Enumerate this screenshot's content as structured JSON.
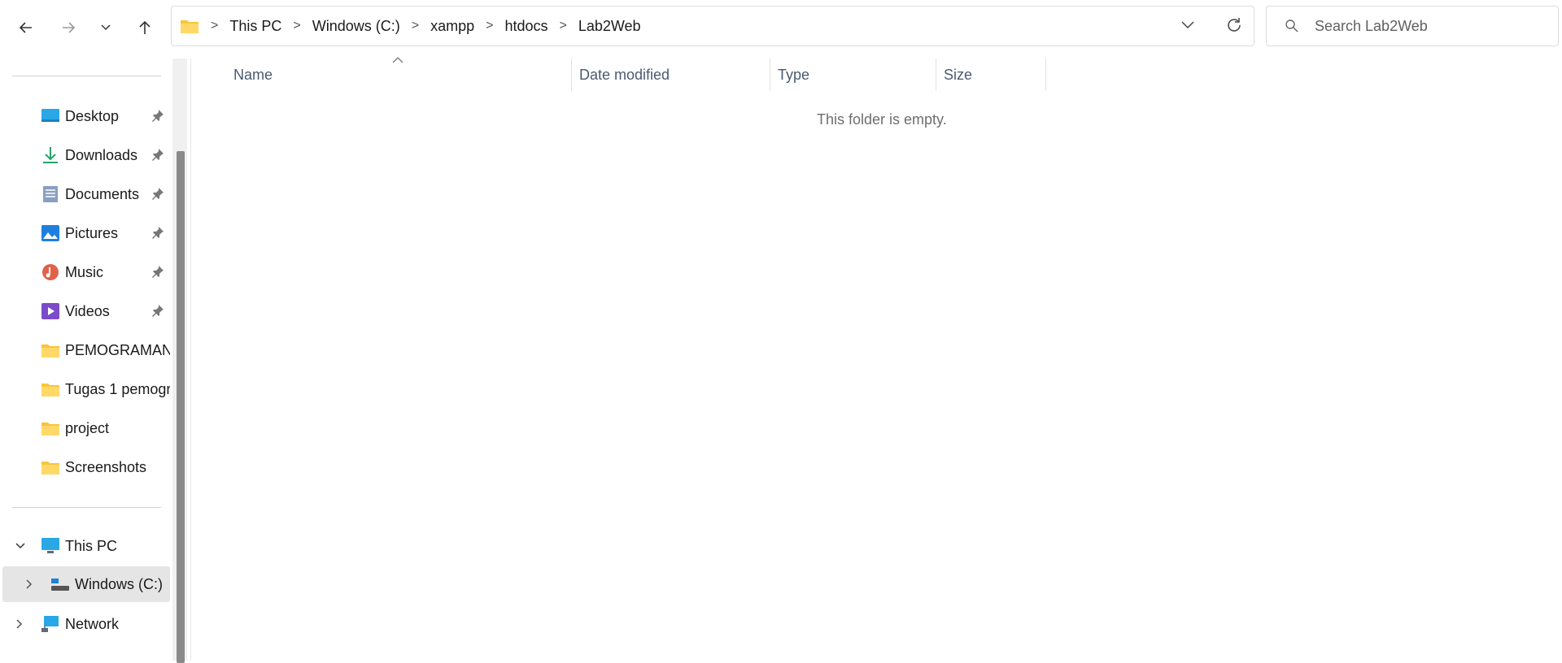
{
  "toolbar": {
    "back_icon": "arrow-left-icon",
    "forward_icon": "arrow-right-icon",
    "recent_icon": "chevron-down-icon",
    "up_icon": "arrow-up-icon"
  },
  "address": {
    "crumbs": [
      "This PC",
      "Windows (C:)",
      "xampp",
      "htdocs",
      "Lab2Web"
    ],
    "separator": ">"
  },
  "search": {
    "placeholder": "Search Lab2Web"
  },
  "sidebar": {
    "quick_access": [
      {
        "label": "Desktop",
        "icon": "desktop-icon",
        "pinned": true
      },
      {
        "label": "Downloads",
        "icon": "download-icon",
        "pinned": true
      },
      {
        "label": "Documents",
        "icon": "documents-icon",
        "pinned": true
      },
      {
        "label": "Pictures",
        "icon": "pictures-icon",
        "pinned": true
      },
      {
        "label": "Music",
        "icon": "music-icon",
        "pinned": true
      },
      {
        "label": "Videos",
        "icon": "videos-icon",
        "pinned": true
      },
      {
        "label": "PEMOGRAMAN",
        "icon": "folder-icon",
        "pinned": false
      },
      {
        "label": "Tugas 1 pemogr",
        "icon": "folder-icon",
        "pinned": false
      },
      {
        "label": "project",
        "icon": "folder-icon",
        "pinned": false
      },
      {
        "label": "Screenshots",
        "icon": "folder-icon",
        "pinned": false
      }
    ],
    "this_pc": "This PC",
    "drive": "Windows (C:)",
    "network": "Network"
  },
  "columns": {
    "name": "Name",
    "date": "Date modified",
    "type": "Type",
    "size": "Size"
  },
  "content": {
    "empty_text": "This folder is empty."
  },
  "colors": {
    "folder": "#f8c53a",
    "accent": "#0067c0",
    "selected_bg": "#e5e5e5"
  }
}
